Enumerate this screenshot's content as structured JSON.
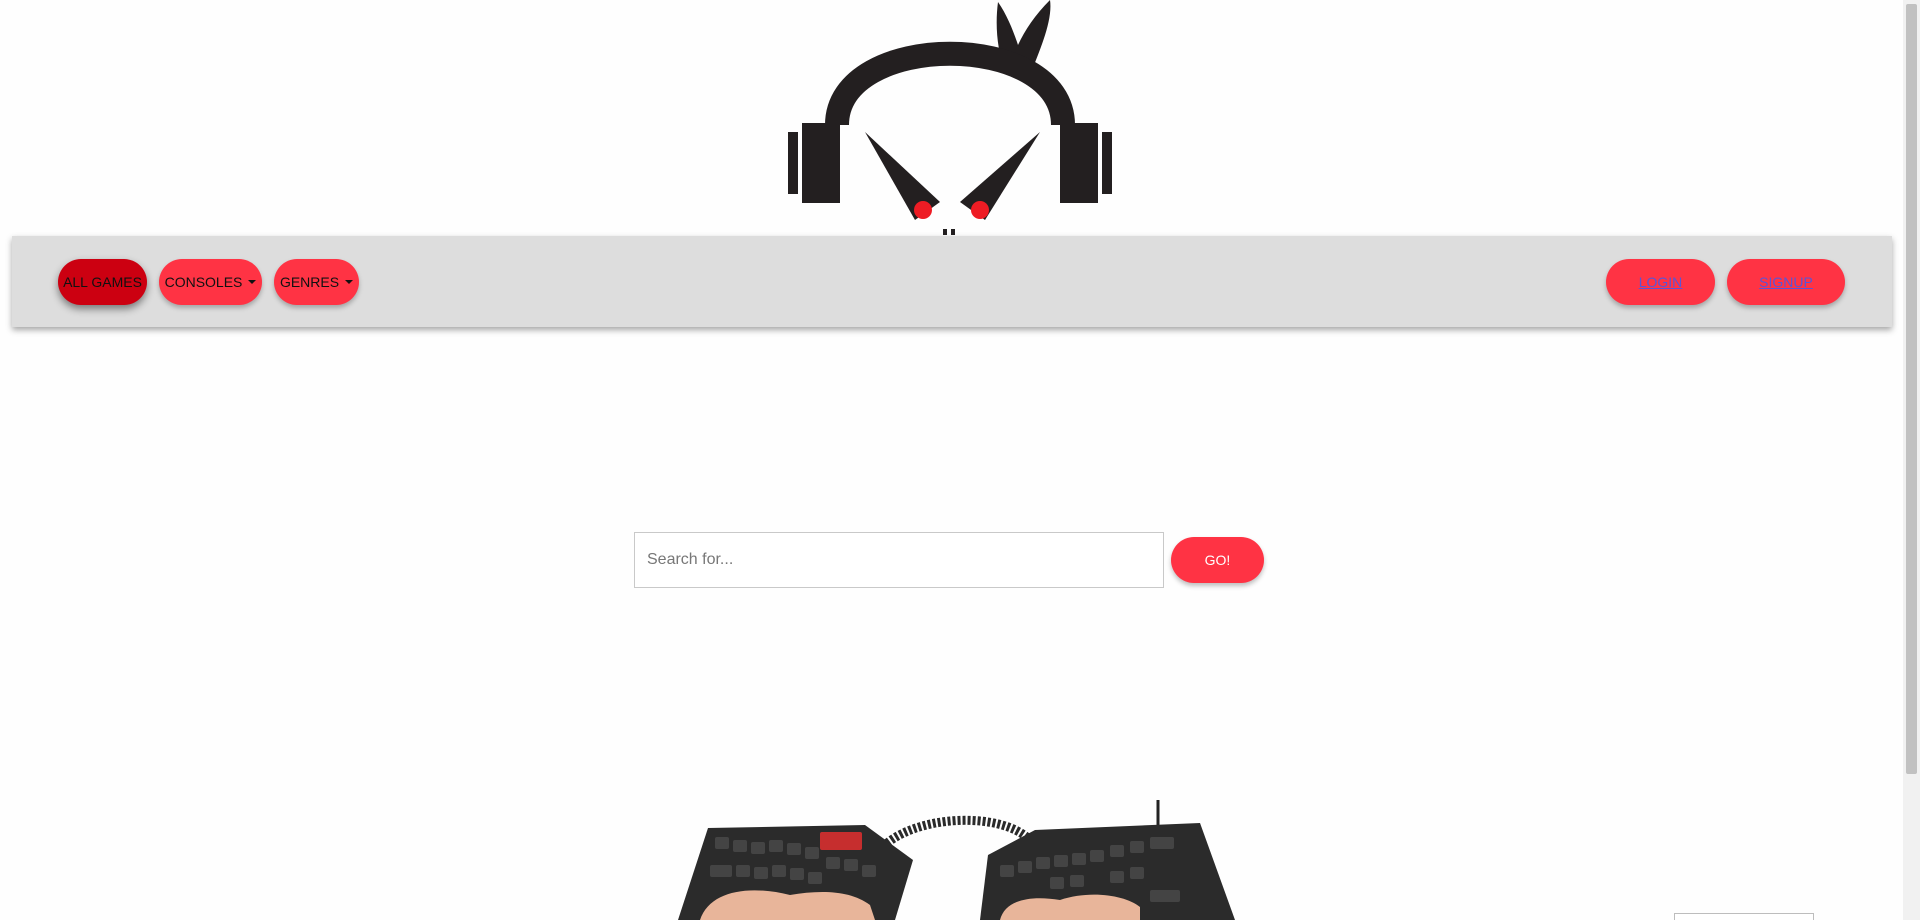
{
  "header": {
    "logo_icon": "gamer-mascot-with-headphones-logo"
  },
  "navbar": {
    "left_items": [
      {
        "label": "ALL GAMES",
        "active": true
      },
      {
        "label": "CONSOLES",
        "dropdown": true
      },
      {
        "label": "GENRES",
        "dropdown": true
      }
    ],
    "right_items": [
      {
        "label": "LOGIN"
      },
      {
        "label": "SIGNUP"
      }
    ]
  },
  "search": {
    "placeholder": "Search for...",
    "value": "",
    "button_label": "GO!"
  },
  "hero": {
    "image_icon": "split-mechanical-keyboard-photo"
  },
  "colors": {
    "accent": "#ff3344",
    "accent_active": "#cc0011",
    "navbar_bg": "#dddddd",
    "link": "#5a55d6"
  }
}
